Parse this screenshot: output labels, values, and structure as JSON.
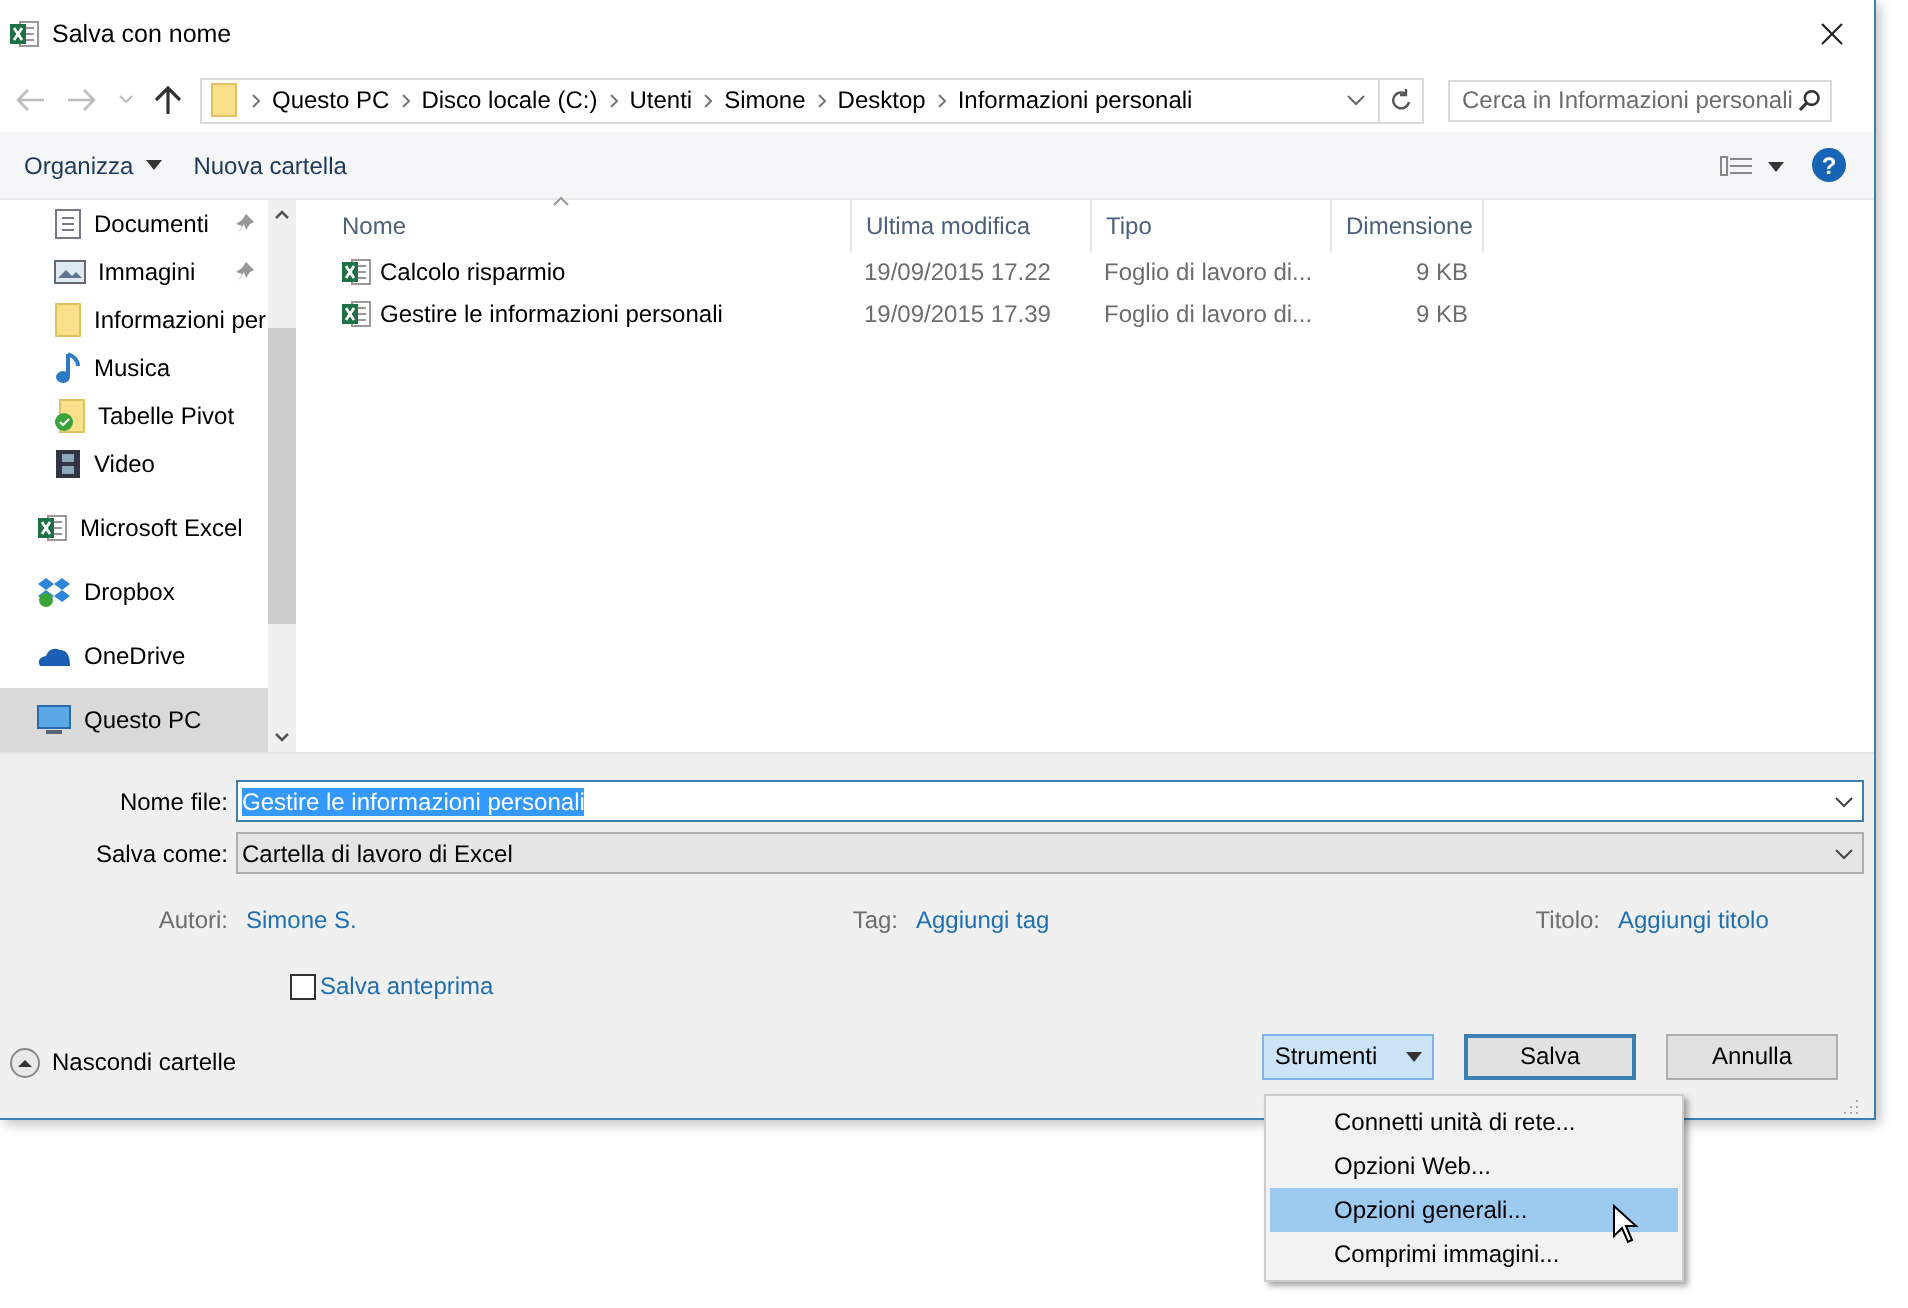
{
  "window": {
    "title": "Salva con nome"
  },
  "address_bar": {
    "segments": [
      "Questo PC",
      "Disco locale (C:)",
      "Utenti",
      "Simone",
      "Desktop",
      "Informazioni personali"
    ]
  },
  "search": {
    "placeholder": "Cerca in Informazioni personali"
  },
  "toolbar": {
    "organize": "Organizza",
    "new_folder": "Nuova cartella",
    "help": "?"
  },
  "sidebar": {
    "quick_access": [
      {
        "label": "Documenti",
        "kind": "documents",
        "pinned": true,
        "selected": false
      },
      {
        "label": "Immagini",
        "kind": "pictures",
        "pinned": true,
        "selected": false
      },
      {
        "label": "Informazioni per",
        "kind": "folder",
        "pinned": false,
        "selected": false
      },
      {
        "label": "Musica",
        "kind": "music",
        "pinned": false,
        "selected": false
      },
      {
        "label": "Tabelle Pivot",
        "kind": "synced-folder",
        "pinned": false,
        "selected": false
      },
      {
        "label": "Video",
        "kind": "video",
        "pinned": false,
        "selected": false
      }
    ],
    "locations": [
      {
        "label": "Microsoft Excel",
        "kind": "excel",
        "selected": false
      },
      {
        "label": "Dropbox",
        "kind": "dropbox",
        "selected": false
      },
      {
        "label": "OneDrive",
        "kind": "onedrive",
        "selected": false
      },
      {
        "label": "Questo PC",
        "kind": "pc",
        "selected": true
      }
    ]
  },
  "table": {
    "columns": [
      "Nome",
      "Ultima modifica",
      "Tipo",
      "Dimensione"
    ],
    "rows": [
      {
        "name": "Calcolo risparmio",
        "modified": "19/09/2015 17.22",
        "type": "Foglio di lavoro di...",
        "size": "9 KB"
      },
      {
        "name": "Gestire le informazioni personali",
        "modified": "19/09/2015 17.39",
        "type": "Foglio di lavoro di...",
        "size": "9 KB"
      }
    ]
  },
  "form": {
    "file_name_label": "Nome file:",
    "file_name": "Gestire le informazioni personali",
    "save_as_label": "Salva come:",
    "save_as": "Cartella di lavoro di Excel",
    "metadata": [
      {
        "label": "Autori:",
        "value": "Simone S."
      },
      {
        "label": "Tag:",
        "value": "Aggiungi tag"
      },
      {
        "label": "Titolo:",
        "value": "Aggiungi titolo"
      }
    ],
    "preview": {
      "label": "Salva anteprima",
      "checked": false
    }
  },
  "footer": {
    "hide_folders": "Nascondi cartelle",
    "tools": {
      "label": "Strumenti",
      "expanded": true
    },
    "save": "Salva",
    "cancel": "Annulla"
  },
  "tools_menu": [
    {
      "label": "Connetti unità di rete...",
      "selected": false
    },
    {
      "label": "Opzioni Web...",
      "selected": false
    },
    {
      "label": "Opzioni generali...",
      "selected": true
    },
    {
      "label": "Comprimi immagini...",
      "selected": false
    }
  ]
}
